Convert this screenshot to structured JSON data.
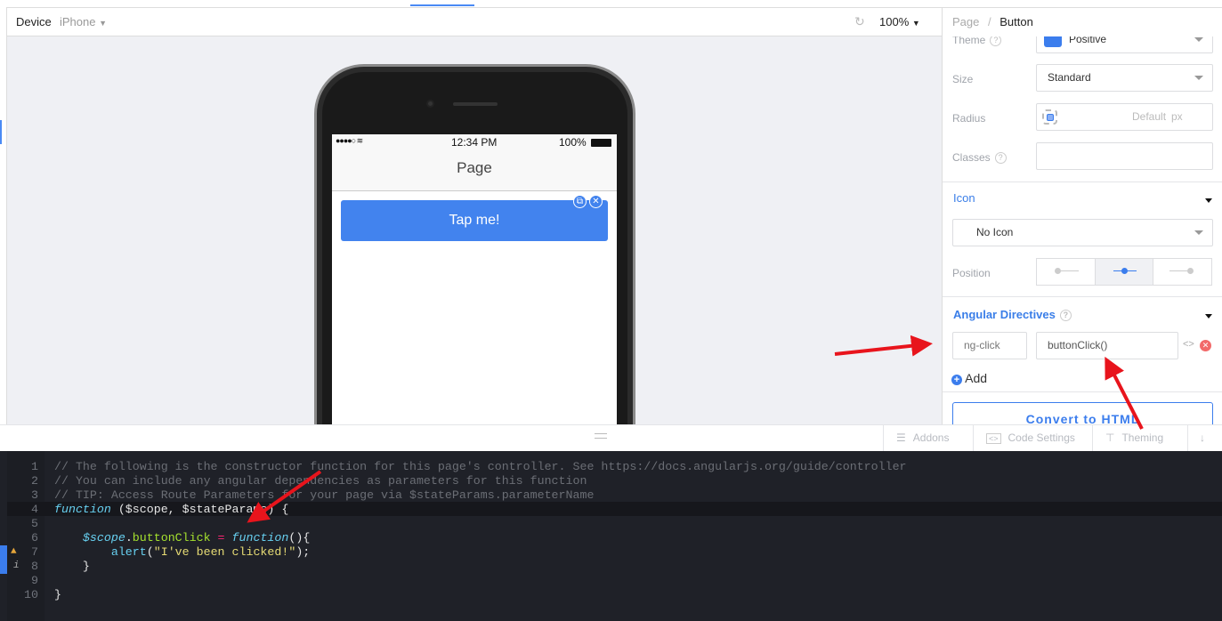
{
  "header": {
    "device_label": "Device",
    "device_value": "iPhone",
    "zoom": "100%"
  },
  "phone": {
    "time": "12:34 PM",
    "battery": "100%",
    "nav_title": "Page",
    "button_label": "Tap me!"
  },
  "panel": {
    "breadcrumb": [
      "Page",
      "/",
      "Button"
    ],
    "theme": {
      "label": "Theme",
      "value": "Positive",
      "color": "#3b7ded"
    },
    "size": {
      "label": "Size",
      "value": "Standard"
    },
    "radius": {
      "label": "Radius",
      "placeholder": "Default",
      "unit": "px"
    },
    "classes": {
      "label": "Classes",
      "value": ""
    },
    "icon_section": {
      "title": "Icon",
      "value": "No Icon",
      "position_label": "Position"
    },
    "directives": {
      "title": "Angular Directives",
      "name": "ng-click",
      "value": "buttonClick()",
      "add_label": "Add"
    },
    "convert_label": "Convert to HTML"
  },
  "toolbar": {
    "addons": "Addons",
    "code_settings": "Code Settings",
    "theming": "Theming"
  },
  "editor": {
    "lines": [
      {
        "n": "1",
        "text": "// The following is the constructor function for this page's controller. See https://docs.angularjs.org/guide/controller"
      },
      {
        "n": "2",
        "text": "// You can include any angular dependencies as parameters for this function"
      },
      {
        "n": "3",
        "text": "// TIP: Access Route Parameters for your page via $stateParams.parameterName"
      },
      {
        "n": "4",
        "kw": "function",
        "rest": " ($scope, $stateParams) {"
      },
      {
        "n": "5",
        "text": ""
      },
      {
        "n": "6",
        "scope": "$scope",
        "prop": "buttonClick",
        "eq": " = ",
        "kw": "function",
        "rest": "(){"
      },
      {
        "n": "7",
        "fn": "alert",
        "str": "\"I've been clicked!\"",
        "rest": ");"
      },
      {
        "n": "8",
        "text": "    }"
      },
      {
        "n": "9",
        "text": ""
      },
      {
        "n": "10",
        "text": "}"
      }
    ]
  },
  "annotation_color": "#e8141c"
}
